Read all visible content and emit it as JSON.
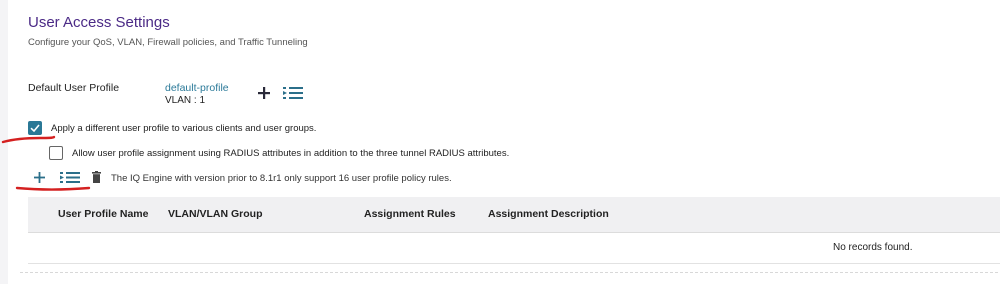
{
  "header": {
    "title": "User Access Settings",
    "subtitle": "Configure your QoS, VLAN, Firewall policies, and Traffic Tunneling"
  },
  "default_profile": {
    "label": "Default User Profile",
    "profile_name": "default-profile",
    "vlan": "VLAN : 1",
    "add_icon": "plus-icon",
    "list_icon": "list-icon"
  },
  "options": {
    "apply_different": {
      "label": "Apply a different user profile to various clients and user groups.",
      "checked": true
    },
    "radius": {
      "label": "Allow user profile assignment using RADIUS attributes in addition to the three tunnel RADIUS attributes.",
      "checked": false
    }
  },
  "toolbar": {
    "icons": [
      "plus-icon",
      "list-icon",
      "trash-icon"
    ],
    "note": "The IQ Engine with version prior to 8.1r1 only support 16 user profile policy rules."
  },
  "table": {
    "columns": [
      "User Profile Name",
      "VLAN/VLAN Group",
      "Assignment Rules",
      "Assignment Description"
    ],
    "empty_message": "No records found."
  },
  "colors": {
    "title": "#4b2a86",
    "link": "#2b7a99",
    "checkbox": "#2a7896",
    "annotation": "#d42020"
  }
}
